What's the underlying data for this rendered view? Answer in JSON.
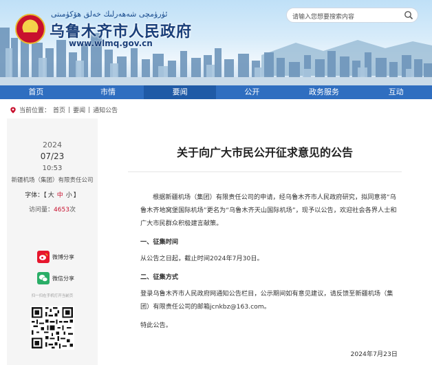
{
  "header": {
    "uyghur_title": "ئۈرۈمچى شەھەرلىك خەلق ھۆكۈمىتى",
    "site_title": "乌鲁木齐市人民政府",
    "site_url": "www.wlmq.gov.cn",
    "search_placeholder": "请输入您想要搜索内容"
  },
  "nav": {
    "items": [
      "首页",
      "市情",
      "要闻",
      "公开",
      "政务服务",
      "互动"
    ],
    "active": "要闻"
  },
  "breadcrumb": {
    "label": "当前位置：",
    "items": [
      "首页",
      "要闻",
      "通知公告"
    ],
    "separator": "|"
  },
  "meta": {
    "year": "2024",
    "date": "07/23",
    "time": "10:53",
    "source": "新疆机场（集团）有限责任公司",
    "fontsize_label": "字体：",
    "fontsize_open": "【",
    "fontsize_close": "】",
    "fontsize_large": "大",
    "fontsize_medium": "中",
    "fontsize_small": "小",
    "views_label": "访问量：",
    "views_count": "4653",
    "views_unit": "次",
    "weibo_share": "微博分享",
    "wechat_share": "微信分享",
    "scan_text": "扫一扫在手机打开当前页"
  },
  "article": {
    "title": "关于向广大市民公开征求意见的公告",
    "para1": "根据新疆机场（集团）有限责任公司的申请，经乌鲁木齐市人民政府研究，拟同意将“乌鲁木齐地窝堡国际机场”更名为“乌鲁木齐天山国际机场”，现予以公告，欢迎社会各界人士和广大市民群众积极建言献策。",
    "heading1": "一、征集时间",
    "para2": "从公告之日起，截止时间2024年7月30日。",
    "heading2": "二、征集方式",
    "para3": "登录乌鲁木齐市人民政府网通知公告栏目，公示期间如有意见建议，请反馈至新疆机场（集团）有限责任公司的邮箱jcnkbz@163.com。",
    "para4": "特此公告。",
    "signature_date": "2024年7月23日"
  },
  "colors": {
    "nav_blue": "#2f6ec0",
    "accent_red": "#c8102e",
    "weibo_red": "#e6162d",
    "wechat_green": "#2aae67"
  }
}
